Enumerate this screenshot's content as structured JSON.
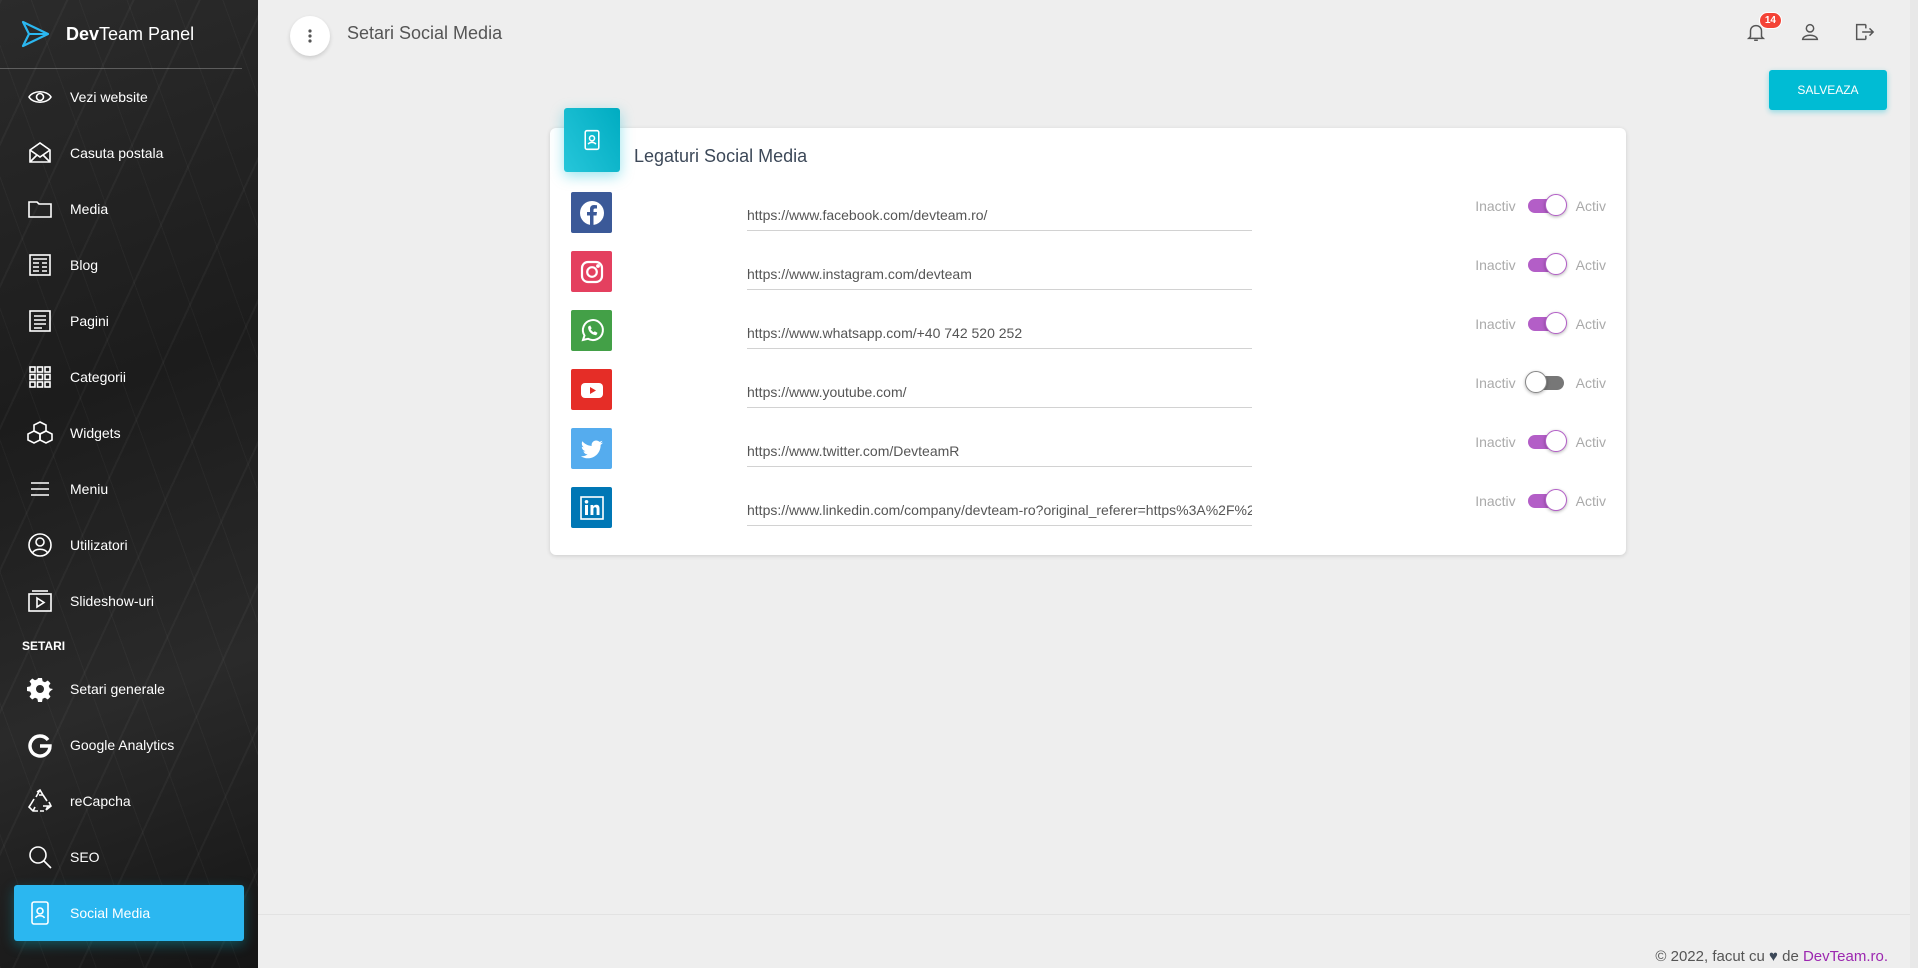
{
  "brand": {
    "bold": "Dev",
    "rest": "Team Panel"
  },
  "sidebar": {
    "items": [
      {
        "label": "Vezi website",
        "icon": "eye-icon"
      },
      {
        "label": "Casuta postala",
        "icon": "mail-icon"
      },
      {
        "label": "Media",
        "icon": "folder-icon"
      },
      {
        "label": "Blog",
        "icon": "newspaper-icon"
      },
      {
        "label": "Pagini",
        "icon": "page-icon"
      },
      {
        "label": "Categorii",
        "icon": "grid-icon"
      },
      {
        "label": "Widgets",
        "icon": "cubes-icon"
      },
      {
        "label": "Meniu",
        "icon": "menu-icon"
      },
      {
        "label": "Utilizatori",
        "icon": "user-circle-icon"
      },
      {
        "label": "Slideshow-uri",
        "icon": "slideshow-icon"
      }
    ],
    "section_label": "SETARI",
    "settings_items": [
      {
        "label": "Setari generale",
        "icon": "gear-icon"
      },
      {
        "label": "Google Analytics",
        "icon": "google-icon"
      },
      {
        "label": "reCapcha",
        "icon": "recycle-icon"
      },
      {
        "label": "SEO",
        "icon": "search-icon"
      },
      {
        "label": "Social Media",
        "icon": "contact-card-icon",
        "active": true
      }
    ]
  },
  "topbar": {
    "title": "Setari Social Media",
    "notifications_count": "14"
  },
  "actions": {
    "save_label": "SALVEAZA"
  },
  "card": {
    "title": "Legaturi Social Media",
    "rows": [
      {
        "network": "facebook",
        "url": "https://www.facebook.com/devteam.ro/",
        "active": true,
        "color": "#3b5998"
      },
      {
        "network": "instagram",
        "url": "https://www.instagram.com/devteam",
        "active": true,
        "color": "#e4405f"
      },
      {
        "network": "whatsapp",
        "url": "https://www.whatsapp.com/+40 742 520 252",
        "active": true,
        "color": "#43a047"
      },
      {
        "network": "youtube",
        "url": "https://www.youtube.com/",
        "active": false,
        "color": "#e52d27"
      },
      {
        "network": "twitter",
        "url": "https://www.twitter.com/DevteamR",
        "active": true,
        "color": "#55acee"
      },
      {
        "network": "linkedin",
        "url": "https://www.linkedin.com/company/devteam-ro?original_referer=https%3A%2F%2",
        "active": true,
        "color": "#0077b5"
      }
    ],
    "toggle_off_label": "Inactiv",
    "toggle_on_label": "Activ"
  },
  "footer": {
    "prefix": "© 2022, facut cu",
    "heart": "♥",
    "middle": "de",
    "link": "DevTeam.ro."
  },
  "colors": {
    "accent": "#00bcd4",
    "active_nav": "#2bb7f0",
    "toggle_on": "#b35ec7",
    "badge": "#f44336"
  }
}
